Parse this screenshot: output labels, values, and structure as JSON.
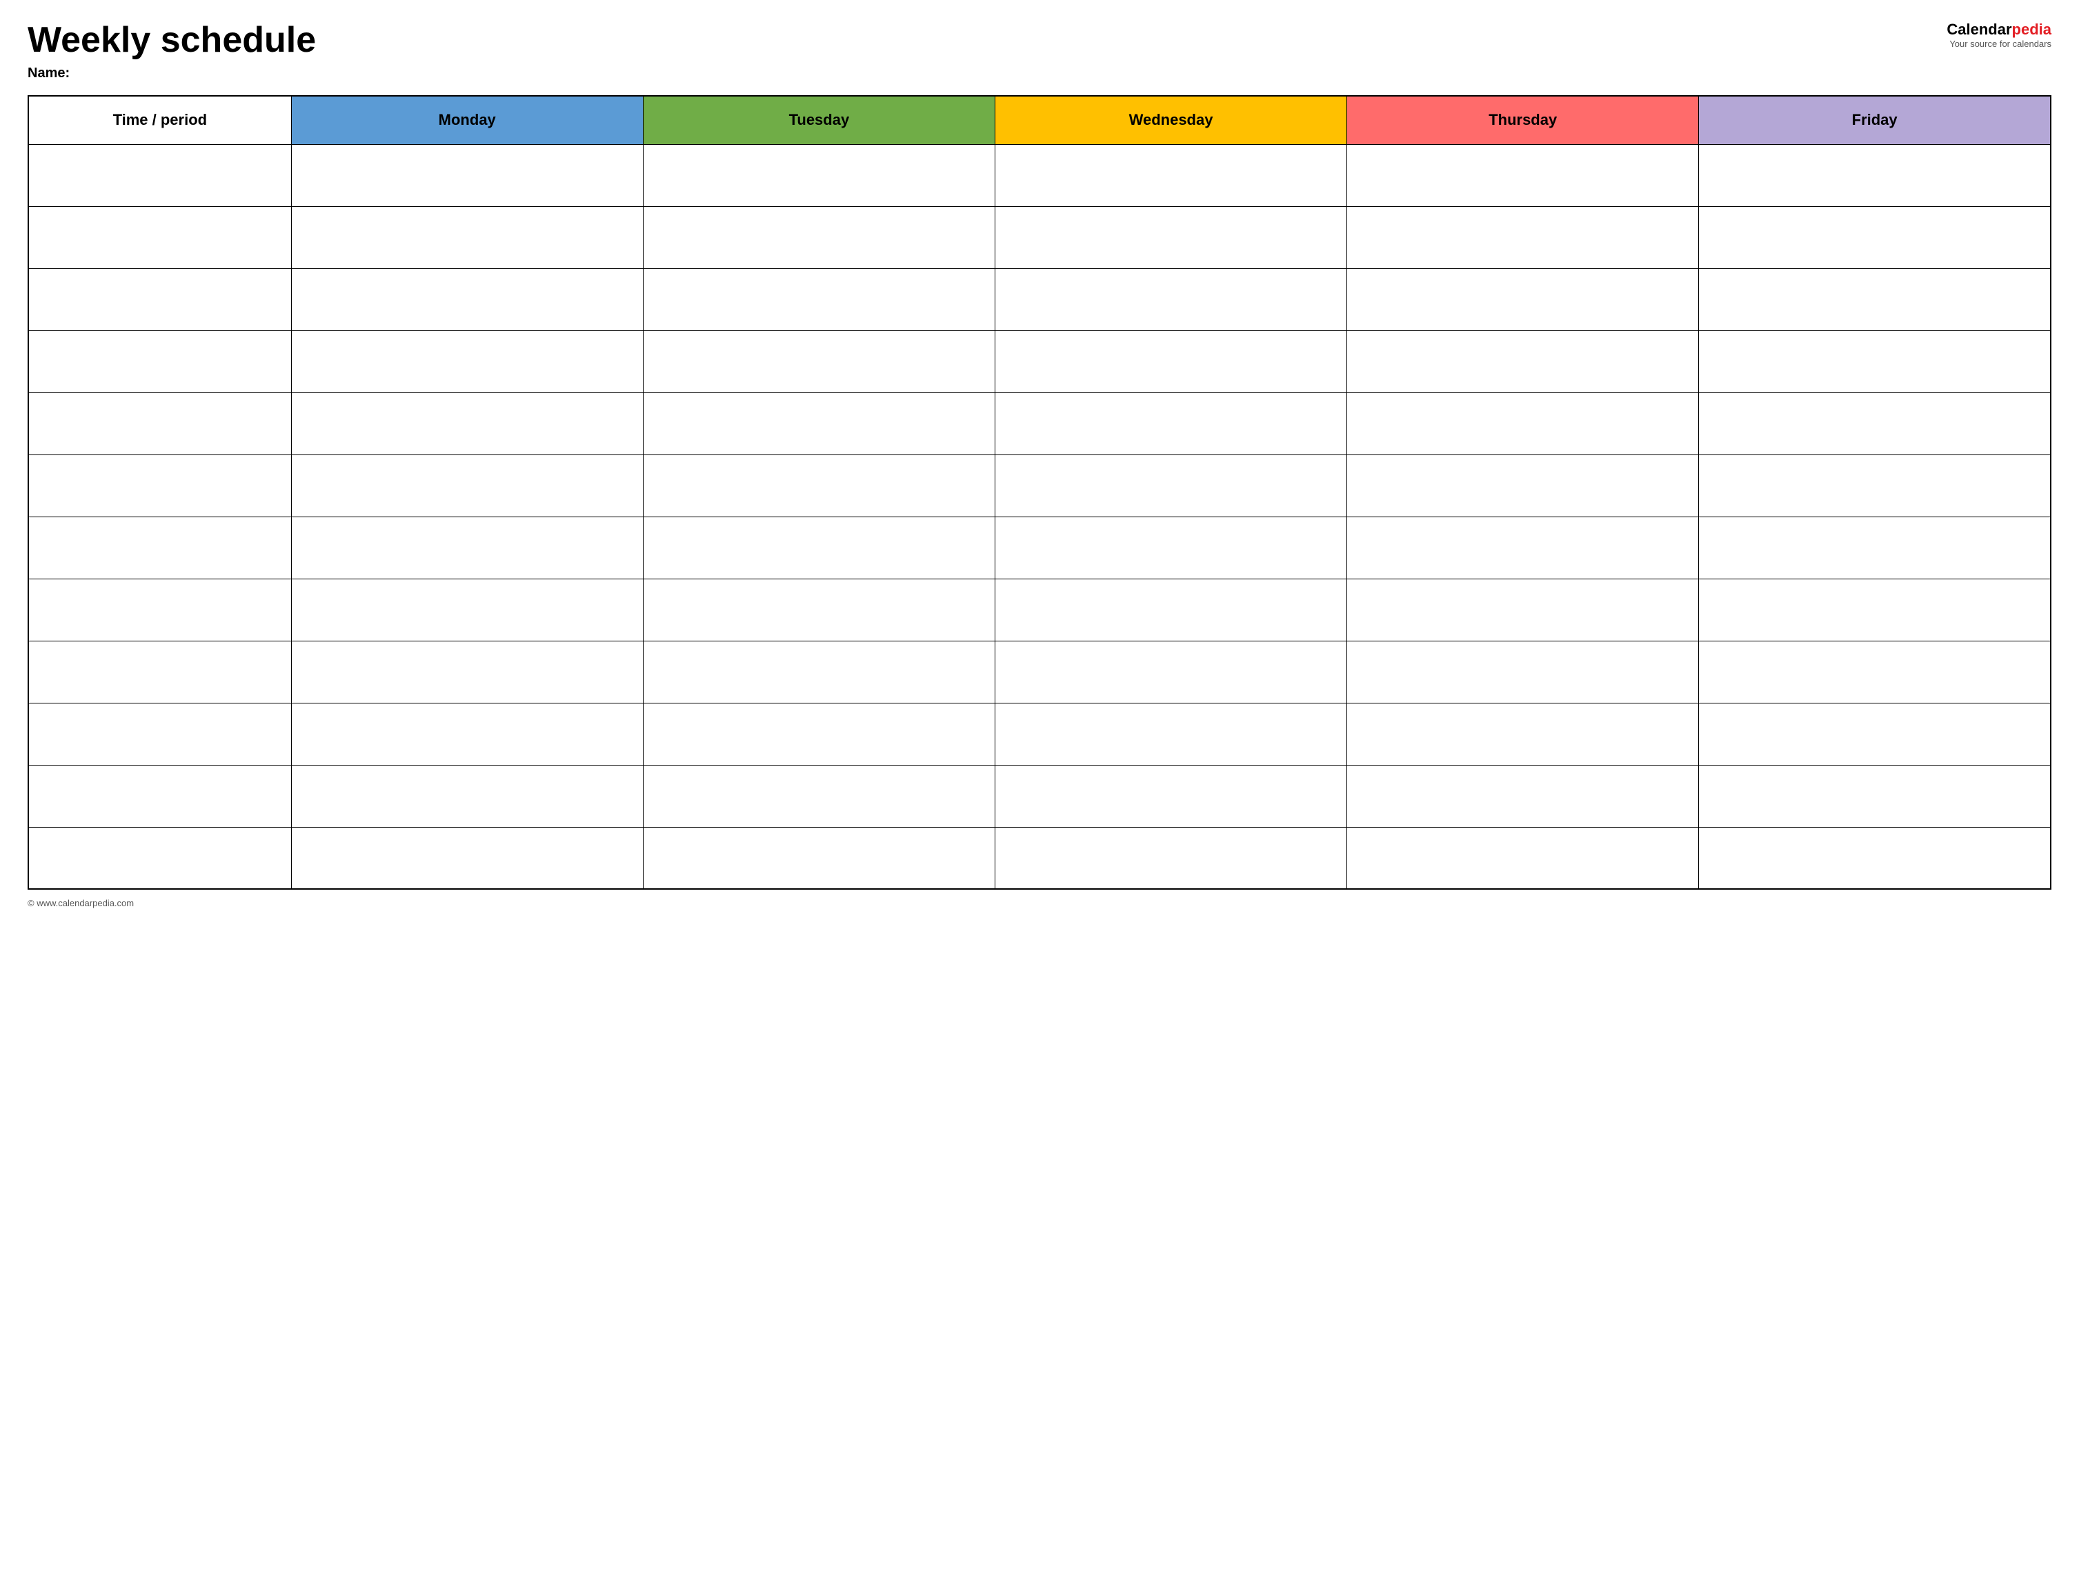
{
  "header": {
    "title": "Weekly schedule",
    "name_label": "Name:",
    "logo_calendar": "Calendar",
    "logo_pedia": "pedia",
    "logo_tagline": "Your source for calendars",
    "logo_url": "Calendarpedia"
  },
  "table": {
    "columns": [
      {
        "id": "time",
        "label": "Time / period",
        "color": "#ffffff"
      },
      {
        "id": "monday",
        "label": "Monday",
        "color": "#5b9bd5"
      },
      {
        "id": "tuesday",
        "label": "Tuesday",
        "color": "#70ad47"
      },
      {
        "id": "wednesday",
        "label": "Wednesday",
        "color": "#ffc000"
      },
      {
        "id": "thursday",
        "label": "Thursday",
        "color": "#ff6b6b"
      },
      {
        "id": "friday",
        "label": "Friday",
        "color": "#b4a7d6"
      }
    ],
    "row_count": 12
  },
  "footer": {
    "copyright": "© www.calendarpedia.com"
  }
}
